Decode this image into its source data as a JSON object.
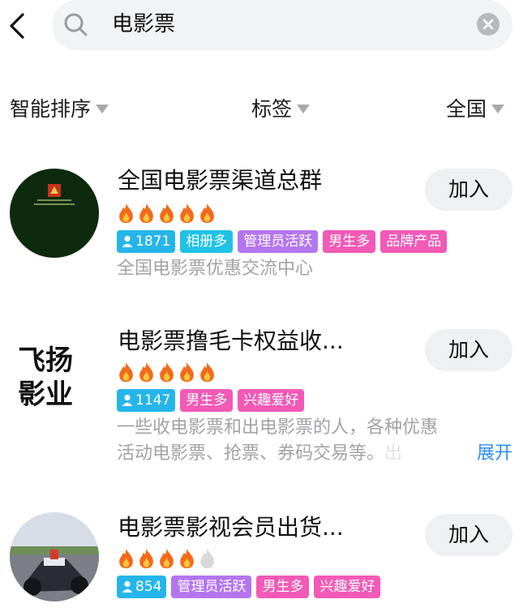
{
  "search": {
    "query": "电影票"
  },
  "filters": [
    {
      "label": "智能排序"
    },
    {
      "label": "标签"
    },
    {
      "label": "全国"
    }
  ],
  "groups": [
    {
      "title": "全国电影票渠道总群",
      "join_label": "加入",
      "rating": 5,
      "member_count": "1871",
      "tags": [
        "相册多",
        "管理员活跃",
        "男生多",
        "品牌产品"
      ],
      "description": "全国电影票优惠交流中心"
    },
    {
      "title": "电影票撸毛卡权益收...",
      "join_label": "加入",
      "rating": 5,
      "avatar_text": [
        "飞扬",
        "影业"
      ],
      "member_count": "1147",
      "tags": [
        "男生多",
        "兴趣爱好"
      ],
      "description_line1": "一些收电影票和出电影票的人，各种优惠",
      "description_line2": "活动电影票、抢票、券码交易等。",
      "description_fade": "出",
      "expand_label": "展开"
    },
    {
      "title": "电影票影视会员出货...",
      "join_label": "加入",
      "rating": 4,
      "member_count": "854",
      "tags": [
        "管理员活跃",
        "男生多",
        "兴趣爱好"
      ]
    }
  ],
  "colors": {
    "count_tag": "#25b5ea",
    "album_tag": "#1fc2e6",
    "admin_tag": "#b476f0",
    "pink_tag": "#f25ab6",
    "flame": "#f26a1b",
    "flame_empty": "#d9d9d9",
    "expand": "#2b8ef2"
  }
}
